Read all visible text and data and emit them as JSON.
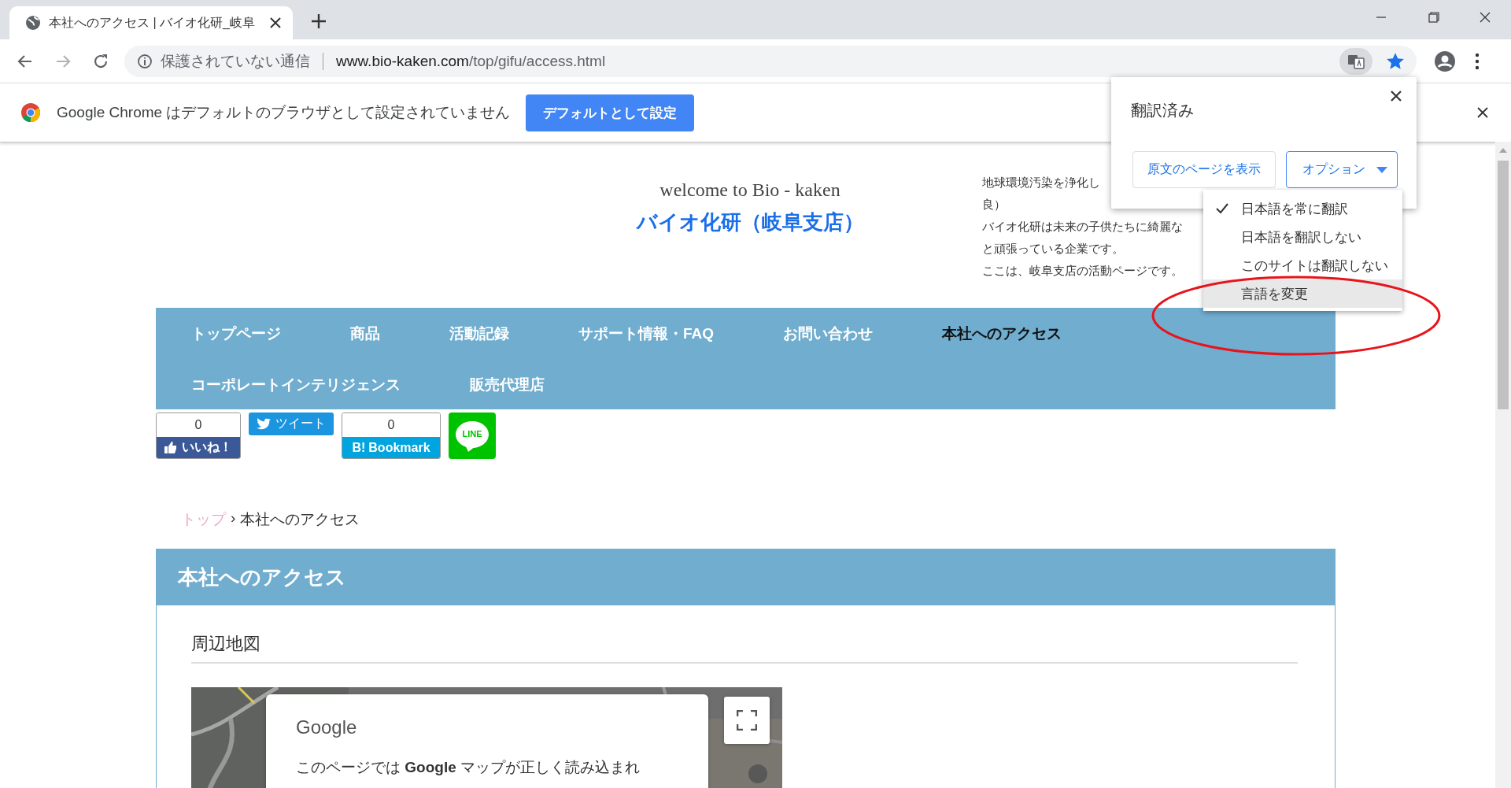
{
  "browser": {
    "tab": {
      "title": "本社へのアクセス | バイオ化研_岐阜",
      "selected": true
    },
    "toolbar": {
      "security_label": "保護されていない通信",
      "url_host": "www.bio-kaken.com",
      "url_path": "/top/gifu/access.html",
      "bookmarked": true
    },
    "infobar": {
      "message": "Google Chrome はデフォルトのブラウザとして設定されていません",
      "button": "デフォルトとして設定"
    }
  },
  "translate_popup": {
    "title": "翻訳済み",
    "buttons": [
      {
        "label": "原文のページを表示",
        "kind": "plain"
      },
      {
        "label": "オプション",
        "kind": "dropdown"
      }
    ],
    "menu": [
      {
        "label": "日本語を常に翻訳",
        "checked": true,
        "selected": false
      },
      {
        "label": "日本語を翻訳しない",
        "checked": false,
        "selected": false
      },
      {
        "label": "このサイトは翻訳しない",
        "checked": false,
        "selected": false
      },
      {
        "label": "言語を変更",
        "checked": false,
        "selected": true
      }
    ]
  },
  "annotation": {
    "kind": "ellipse"
  },
  "page": {
    "header": {
      "welcome": "welcome to Bio - kaken",
      "title": "バイオ化研（岐阜支店）",
      "intro": [
        "地球環境汚染を浄化し",
        "良）",
        "バイオ化研は未来の子供たちに綺麗な",
        "と頑張っている企業です。",
        "ここは、岐阜支店の活動ページです。"
      ]
    },
    "nav": {
      "items": [
        {
          "label": "トップページ",
          "selected": false
        },
        {
          "label": "商品",
          "selected": false
        },
        {
          "label": "活動記録",
          "selected": false
        },
        {
          "label": "サポート情報・FAQ",
          "selected": false
        },
        {
          "label": "お問い合わせ",
          "selected": false
        },
        {
          "label": "本社へのアクセス",
          "selected": true
        },
        {
          "label": "コーポレートインテリジェンス",
          "selected": false
        },
        {
          "label": "販売代理店",
          "selected": false
        }
      ]
    },
    "social": {
      "like": {
        "count": "0",
        "label": "いいね！"
      },
      "tweet": {
        "label": "ツイート"
      },
      "hatena": {
        "count": "0",
        "logo": "B!",
        "label": "Bookmark"
      },
      "line": {
        "label": "LINE"
      }
    },
    "breadcrumb": {
      "separator": "›",
      "items": [
        {
          "label": "トップ",
          "kind": "link"
        },
        {
          "label": "本社へのアクセス",
          "kind": "current"
        }
      ]
    },
    "section": {
      "title": "本社へのアクセス",
      "subheading": "周辺地図",
      "map": {
        "kind": "picture",
        "notice_title": "Google",
        "notice_text": "このページでは **Google** マップが正しく読み込まれ"
      }
    }
  }
}
